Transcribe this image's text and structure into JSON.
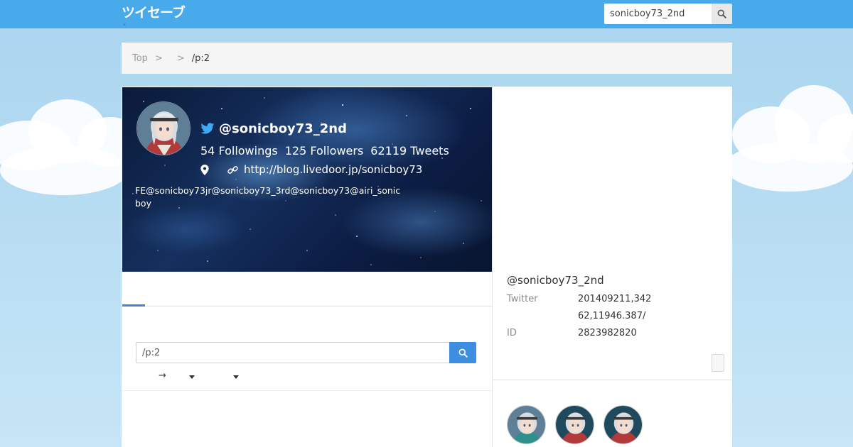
{
  "header": {
    "logo_text": "ツイセーブ",
    "search_value": "sonicboy73_2nd",
    "tiny_mark": "\""
  },
  "breadcrumb": {
    "top": "Top",
    "sep1": ">",
    "sep2": ">",
    "current": "/p:2"
  },
  "profile": {
    "handle": "@sonicboy73_2nd",
    "followings": "54 Followings",
    "followers": "125 Followers",
    "tweets": "62119 Tweets",
    "url": "http://blog.livedoor.jp/sonicboy73",
    "bio": "FE@sonicboy73jr@sonicboy73_3rd@sonicboy73@airi_sonicboy"
  },
  "inner_search": {
    "value": "/p:2"
  },
  "sort": {
    "arrow": "→"
  },
  "sidebar": {
    "name": "@sonicboy73_2nd",
    "rows": [
      {
        "label": "Twitter",
        "value": "201409211,342"
      },
      {
        "label": "",
        "value": "62,11946.387/"
      },
      {
        "label": "ID",
        "value": "2823982820"
      }
    ]
  },
  "colors": {
    "topbar": "#48aaeb",
    "accent": "#3d8de0",
    "tab_active": "#4a7fd4"
  }
}
